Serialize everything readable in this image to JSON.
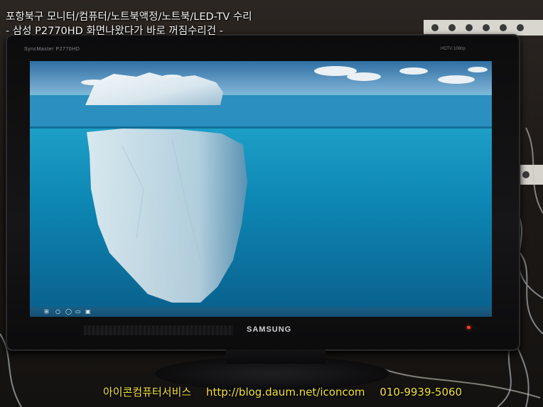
{
  "caption": {
    "line1": "포항북구 모니터/컴퓨터/노트북액정/노트북/LED-TV 수리",
    "line2": "- 삼성 P2770HD 화면나왔다가 바로 꺼짐수리건 -"
  },
  "monitor": {
    "brand_logo": "SAMSUNG",
    "bezel_model": "SyncMaster P2770HD",
    "bezel_badge": "HDTV 1080p",
    "screen": {
      "scene": "iceberg-wallpaper",
      "taskbar_icons": [
        "windows-start-icon",
        "search-icon",
        "cortana-icon",
        "task-view-icon",
        "file-explorer-icon"
      ]
    },
    "power_led_color": "#ff3a2a"
  },
  "watermark": {
    "shop_name": "아이콘컴퓨터서비스",
    "blog_url": "http://blog.daum.net/iconcom",
    "phone": "010-9939-5060",
    "text_color": "#f2e23a"
  }
}
